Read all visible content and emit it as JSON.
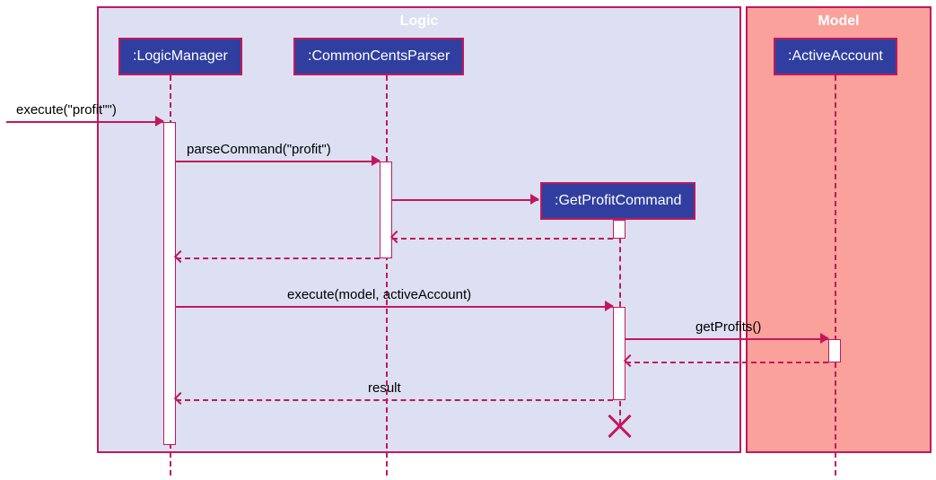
{
  "frames": {
    "logic": {
      "title": "Logic"
    },
    "model": {
      "title": "Model"
    }
  },
  "participants": {
    "logicManager": {
      "label": ":LogicManager"
    },
    "commonCentsParser": {
      "label": ":CommonCentsParser"
    },
    "getProfitCommand": {
      "label": ":GetProfitCommand"
    },
    "activeAccount": {
      "label": ":ActiveAccount"
    }
  },
  "messages": {
    "execute_entry": {
      "label": "execute(\"profit\"\")"
    },
    "parseCommand": {
      "label": "parseCommand(\"profit\")"
    },
    "execute_model": {
      "label": "execute(model, activeAccount)"
    },
    "getProfits": {
      "label": "getProfits()"
    },
    "result": {
      "label": "result"
    }
  },
  "chart_data": {
    "type": "sequence-diagram",
    "frames": [
      {
        "name": "Logic",
        "participants": [
          ":LogicManager",
          ":CommonCentsParser",
          ":GetProfitCommand"
        ]
      },
      {
        "name": "Model",
        "participants": [
          ":ActiveAccount"
        ]
      }
    ],
    "participants": [
      ":LogicManager",
      ":CommonCentsParser",
      ":GetProfitCommand",
      ":ActiveAccount"
    ],
    "messages": [
      {
        "from": "external",
        "to": ":LogicManager",
        "label": "execute(\"profit\"\")",
        "type": "call"
      },
      {
        "from": ":LogicManager",
        "to": ":CommonCentsParser",
        "label": "parseCommand(\"profit\")",
        "type": "call"
      },
      {
        "from": ":CommonCentsParser",
        "to": ":GetProfitCommand",
        "label": "",
        "type": "create"
      },
      {
        "from": ":GetProfitCommand",
        "to": ":CommonCentsParser",
        "label": "",
        "type": "return"
      },
      {
        "from": ":CommonCentsParser",
        "to": ":LogicManager",
        "label": "",
        "type": "return"
      },
      {
        "from": ":LogicManager",
        "to": ":GetProfitCommand",
        "label": "execute(model, activeAccount)",
        "type": "call"
      },
      {
        "from": ":GetProfitCommand",
        "to": ":ActiveAccount",
        "label": "getProfits()",
        "type": "call"
      },
      {
        "from": ":ActiveAccount",
        "to": ":GetProfitCommand",
        "label": "",
        "type": "return"
      },
      {
        "from": ":GetProfitCommand",
        "to": ":LogicManager",
        "label": "result",
        "type": "return"
      },
      {
        "from": ":GetProfitCommand",
        "to": null,
        "label": "",
        "type": "destroy"
      }
    ]
  }
}
